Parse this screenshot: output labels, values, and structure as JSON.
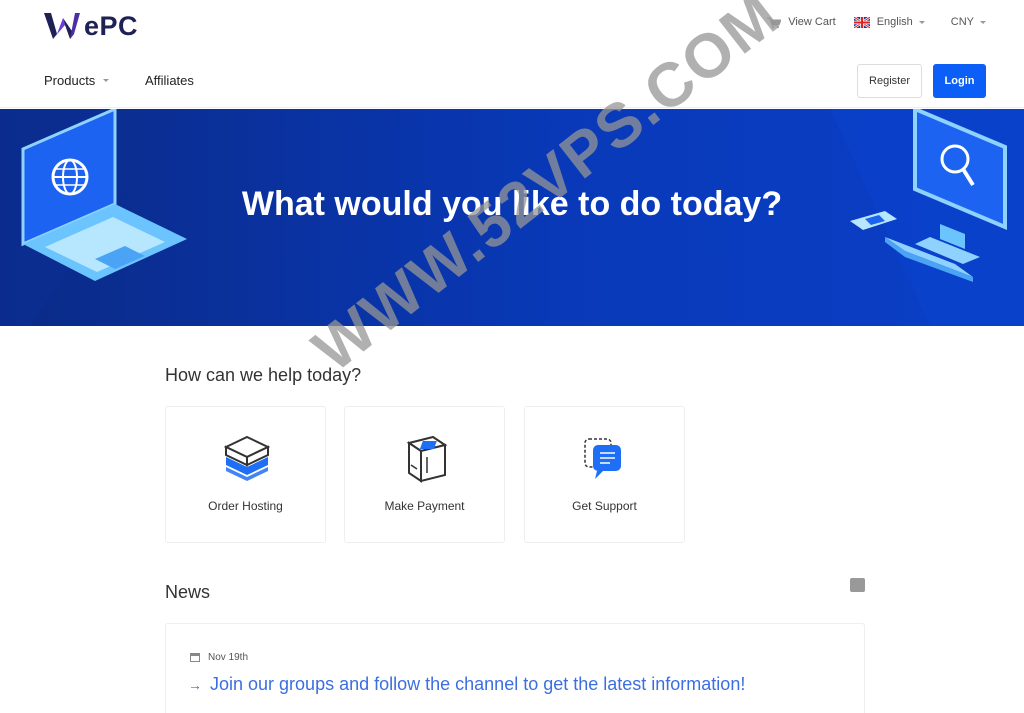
{
  "brand": {
    "logo_mark": "W",
    "logo_text": "ePC"
  },
  "top_links": {
    "cart_label": "View Cart",
    "language_label": "English",
    "currency_label": "CNY"
  },
  "nav": {
    "products_label": "Products",
    "affiliates_label": "Affiliates",
    "register_label": "Register",
    "login_label": "Login"
  },
  "hero": {
    "title": "What would you like to do today?"
  },
  "help": {
    "title": "How can we help today?",
    "cards": [
      {
        "label": "Order Hosting",
        "icon": "server-box-icon"
      },
      {
        "label": "Make Payment",
        "icon": "payment-box-icon"
      },
      {
        "label": "Get Support",
        "icon": "support-chat-icon"
      }
    ]
  },
  "news": {
    "title": "News",
    "items": [
      {
        "date": "Nov 19th",
        "title": "Join our groups and follow the channel to get the latest information!"
      }
    ]
  },
  "watermark": "WWW.52VPS.COM",
  "colors": {
    "primary": "#0c5ff6",
    "hero_bg": "#0939b8",
    "brand_dark": "#1e2154",
    "link": "#3b6fe0"
  }
}
